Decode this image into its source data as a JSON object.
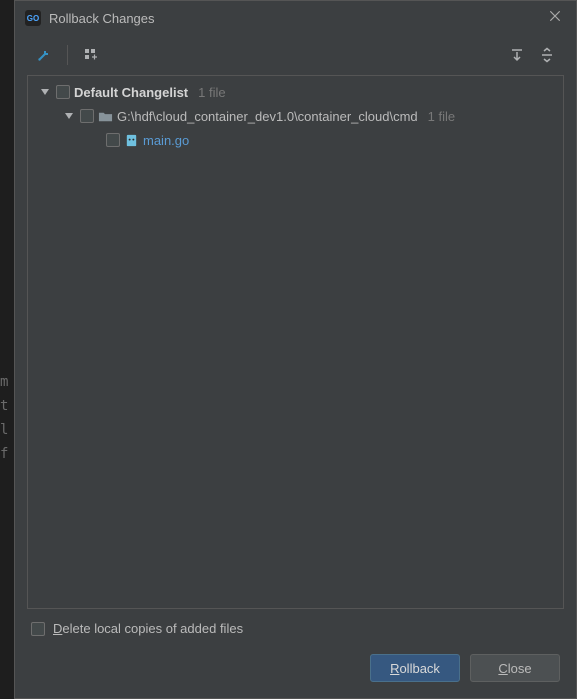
{
  "window": {
    "title": "Rollback Changes",
    "app_icon_text": "GO"
  },
  "tree": {
    "changelist": {
      "label": "Default Changelist",
      "count": "1 file"
    },
    "folder": {
      "path": "G:\\hdf\\cloud_container_dev1.0\\container_cloud\\cmd",
      "count": "1 file"
    },
    "file": {
      "name": "main.go"
    }
  },
  "options": {
    "delete_local_label_pre": "D",
    "delete_local_label_rest": "elete local copies of added files"
  },
  "buttons": {
    "rollback_pre": "R",
    "rollback_rest": "ollback",
    "close_pre": "C",
    "close_rest": "lose"
  }
}
